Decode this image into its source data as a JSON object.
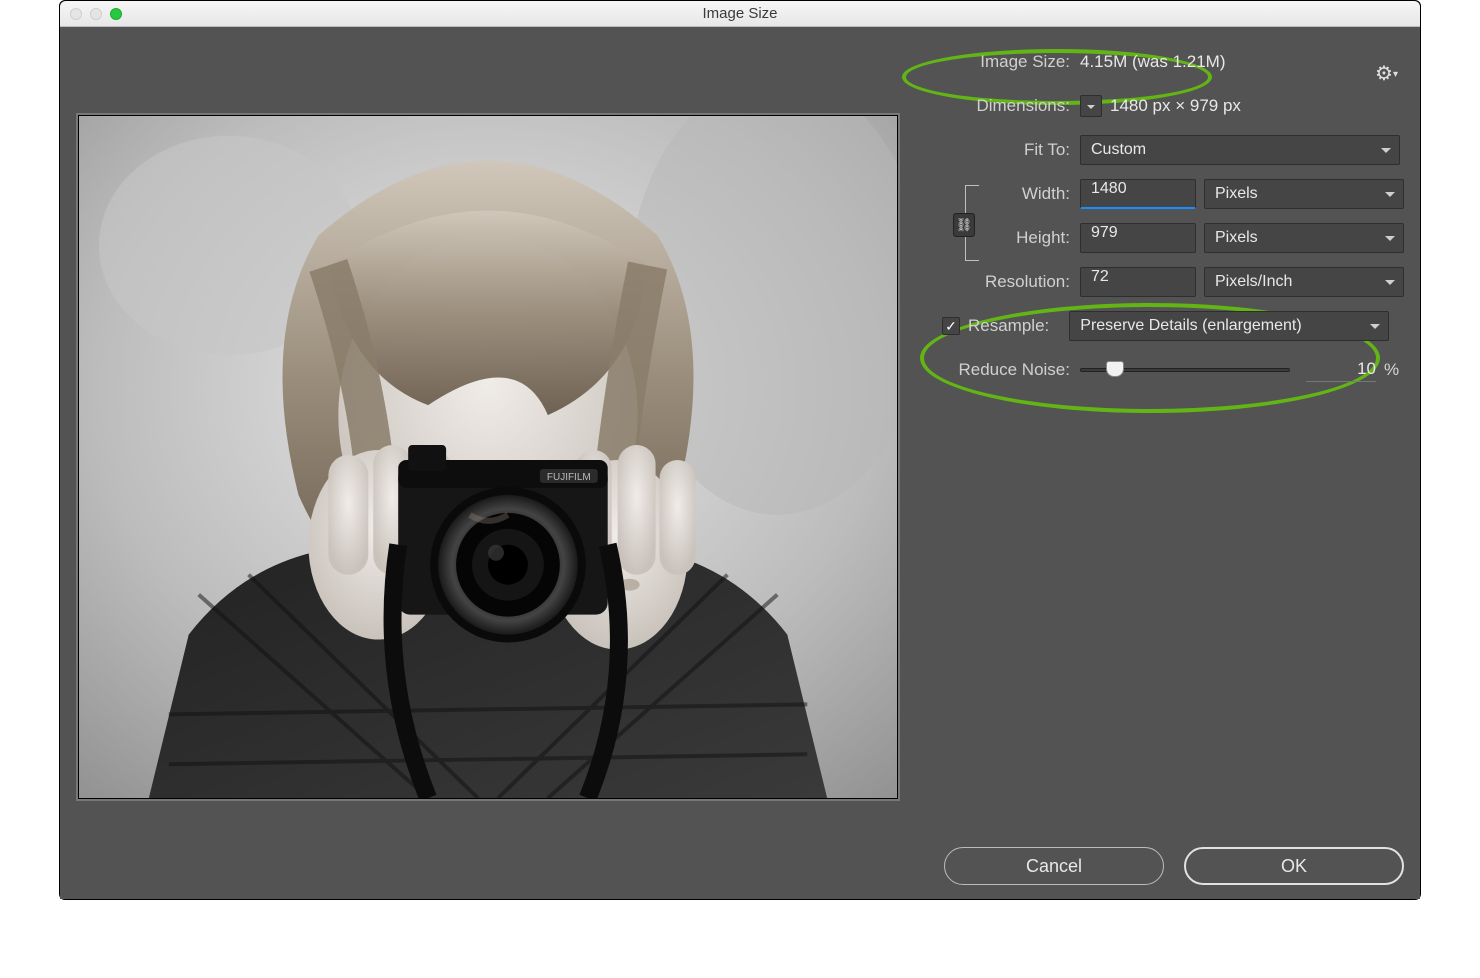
{
  "window": {
    "title": "Image Size"
  },
  "panel": {
    "imageSizeLabel": "Image Size:",
    "imageSizeValue": "4.15M (was 1.21M)",
    "dimensionsLabel": "Dimensions:",
    "dimensionsValue": "1480 px  ×  979 px",
    "fitToLabel": "Fit To:",
    "fitToValue": "Custom",
    "widthLabel": "Width:",
    "widthValue": "1480",
    "widthUnit": "Pixels",
    "heightLabel": "Height:",
    "heightValue": "979",
    "heightUnit": "Pixels",
    "resolutionLabel": "Resolution:",
    "resolutionValue": "72",
    "resolutionUnit": "Pixels/Inch",
    "resampleLabel": "Resample:",
    "resampleValue": "Preserve Details (enlargement)",
    "noiseLabel": "Reduce Noise:",
    "noiseValue": "10",
    "noisePct": "%"
  },
  "footer": {
    "cancel": "Cancel",
    "ok": "OK"
  },
  "linkGlyph": "⛓",
  "gearGlyph": "⚙",
  "check": "✓",
  "colors": {
    "annotate": "#62b515"
  }
}
